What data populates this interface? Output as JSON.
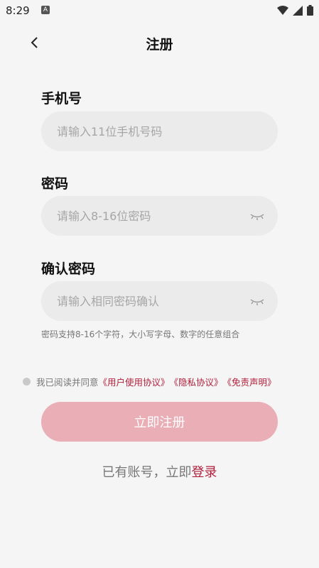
{
  "status": {
    "time": "8:29",
    "notif_glyph": "A"
  },
  "nav": {
    "title": "注册",
    "back_icon": "chevron-left-icon"
  },
  "phone": {
    "label": "手机号",
    "placeholder": "请输入11位手机号码"
  },
  "password": {
    "label": "密码",
    "placeholder": "请输入8-16位密码"
  },
  "confirm": {
    "label": "确认密码",
    "placeholder": "请输入相同密码确认"
  },
  "hint": "密码支持8-16个字符，大小写字母、数字的任意组合",
  "agreement": {
    "prefix": "我已阅读并同意",
    "user_agreement": "《用户使用协议》",
    "privacy": "《隐私协议》",
    "disclaimer": "《免责声明》"
  },
  "submit_label": "立即注册",
  "login": {
    "prefix": "已有账号，立即",
    "link": "登录"
  },
  "colors": {
    "accent": "#b0203c",
    "button": "#e9aeb6",
    "field_bg": "#ebebeb",
    "page_bg": "#f5f5f5"
  }
}
